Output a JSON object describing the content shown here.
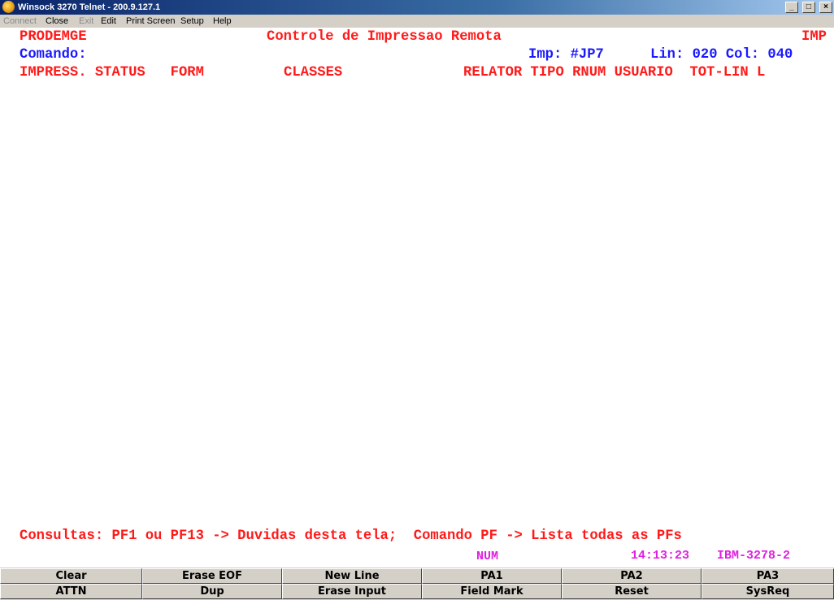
{
  "window": {
    "title": "Winsock 3270 Telnet - 200.9.127.1",
    "minimize_glyph": "_",
    "maximize_glyph": "□",
    "close_glyph": "×"
  },
  "menu": [
    {
      "label": "Connect",
      "enabled": false
    },
    {
      "label": "Close",
      "enabled": true
    },
    {
      "label": "Exit",
      "enabled": false
    },
    {
      "label": "Edit",
      "enabled": true
    },
    {
      "label": "Print Screen",
      "enabled": true
    },
    {
      "label": "Setup",
      "enabled": true
    },
    {
      "label": "Help",
      "enabled": true
    }
  ],
  "screen": {
    "system_name": "PRODEMGE",
    "title": "Controle de Impressao Remota",
    "title_right": "IMP",
    "command_label": "Comando:",
    "printer_info": "Imp: #JP7",
    "position_info": "Lin: 020 Col: 040",
    "headers": {
      "left": "IMPRESS. STATUS   FORM",
      "mid": "CLASSES",
      "right": "RELATOR TIPO RNUM USUARIO  TOT-LIN L"
    },
    "help_line": "Consultas: PF1 ou PF13 -> Duvidas desta tela;  Comando PF -> Lista todas as PFs",
    "colors": {
      "red": "#ff1a1a",
      "blue": "#1a1aff",
      "magenta": "#e020e0",
      "background": "#ffffff"
    }
  },
  "status": {
    "num_indicator": "NUM",
    "time": "14:13:23",
    "terminal": "IBM-3278-2"
  },
  "keypad": {
    "row1": [
      "Clear",
      "Erase EOF",
      "New Line",
      "PA1",
      "PA2",
      "PA3"
    ],
    "row2": [
      "ATTN",
      "Dup",
      "Erase Input",
      "Field Mark",
      "Reset",
      "SysReq"
    ]
  }
}
